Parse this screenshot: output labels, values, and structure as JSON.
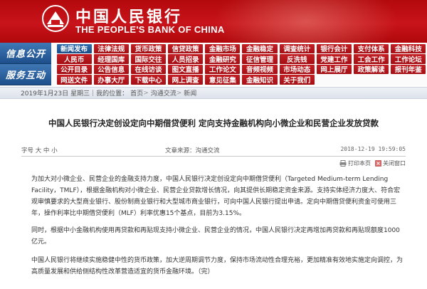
{
  "header": {
    "bank_name_cn": "中国人民银行",
    "bank_name_en": "THE PEOPLE'S BANK OF CHINA",
    "brand_color": "#c8141a"
  },
  "nav": {
    "label_info": "信息公开",
    "label_service": "服务互动",
    "rows": [
      [
        "新闻发布",
        "法律法规",
        "货币政策",
        "信贷政策",
        "金融市场",
        "金融稳定",
        "调查统计",
        "银行会计",
        "支付体系",
        "金融科技"
      ],
      [
        "人民币",
        "经理国库",
        "国际交往",
        "人员招录",
        "金融研究",
        "征信管理",
        "反洗钱",
        "党建工作",
        "工会工作",
        "工作论坛"
      ],
      [
        "公开目录",
        "公告信息",
        "在线访谈",
        "图文直播",
        "工作论文",
        "音频视频",
        "市场动态",
        "网上展厅",
        "政策解读",
        "报刊年鉴"
      ],
      [
        "网送文件",
        "办事大厅",
        "下载中心",
        "网上调查",
        "意见征集",
        "金融知识",
        "关于我们",
        "",
        "",
        ""
      ]
    ]
  },
  "breadcrumb": {
    "date": "2019年1月23日",
    "weekday": "星期三",
    "sep": "|",
    "location_prefix": "我的位置：",
    "home": "首页",
    "gt": ">",
    "section": "沟通交流",
    "current": "新闻"
  },
  "article": {
    "title": "中国人民银行决定创设定向中期借贷便利 定向支持金融机构向小微企业和民营企业发放贷款",
    "author": "字号 大 中 小",
    "source": "文章来源：沟通交流",
    "date": "2018-12-19 19:59:05",
    "tools": {
      "print": "打印本页",
      "close": "关闭窗口"
    },
    "paragraphs": [
      "为加大对小微企业、民营企业的金融支持力度，中国人民银行决定创设定向中期借贷便利（Targeted Medium-term Lending Facility，TMLF），根据金融机构对小微企业、民营企业贷款增长情况，向其提供长期稳定资金来源。支持实体经济力度大、符合宏观审慎要求的大型商业银行、股份制商业银行和大型城市商业银行，可向中国人民银行提出申请。定向中期借贷便利资金可使用三年，操作利率比中期借贷便利（MLF）利率优惠15个基点，目前为3.15%。",
      "同时，根据中小金融机构使用再贷款和再贴现支持小微企业、民营企业的情况，中国人民银行决定再增加再贷款和再贴现额度1000亿元。",
      "中国人民银行将继续实施稳健中性的货币政策，加大逆周期调节力度，保持市场流动性合理充裕，更加精准有效地实施定向调控，为高质量发展和供给侧结构性改革营造适宜的货币金融环境。（完）"
    ]
  }
}
